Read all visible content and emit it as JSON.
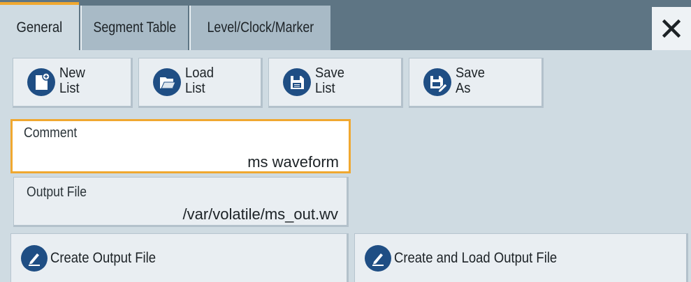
{
  "tabs": [
    {
      "label": "General",
      "active": true
    },
    {
      "label": "Segment Table",
      "active": false
    },
    {
      "label": "Level/Clock/Marker",
      "active": false
    }
  ],
  "close": {
    "icon": "close-icon"
  },
  "list_buttons": {
    "new": {
      "line1": "New",
      "line2": "List",
      "icon": "new-list-icon"
    },
    "load": {
      "line1": "Load",
      "line2": "List",
      "icon": "folder-icon"
    },
    "save": {
      "line1": "Save",
      "line2": "List",
      "icon": "save-icon"
    },
    "save_as": {
      "line1": "Save",
      "line2": "As",
      "icon": "save-as-icon"
    }
  },
  "comment": {
    "label": "Comment",
    "value": "ms waveform"
  },
  "output_file": {
    "label": "Output File",
    "value": "/var/volatile/ms_out.wv"
  },
  "actions": {
    "create": {
      "label": "Create Output File",
      "icon": "pencil-icon"
    },
    "create_load": {
      "label": "Create and Load Output File",
      "icon": "pencil-icon"
    }
  },
  "colors": {
    "accent": "#f0a830",
    "icon_blue": "#1f4e84",
    "tabbar": "#5e7584",
    "panel": "#cfdbe2"
  }
}
